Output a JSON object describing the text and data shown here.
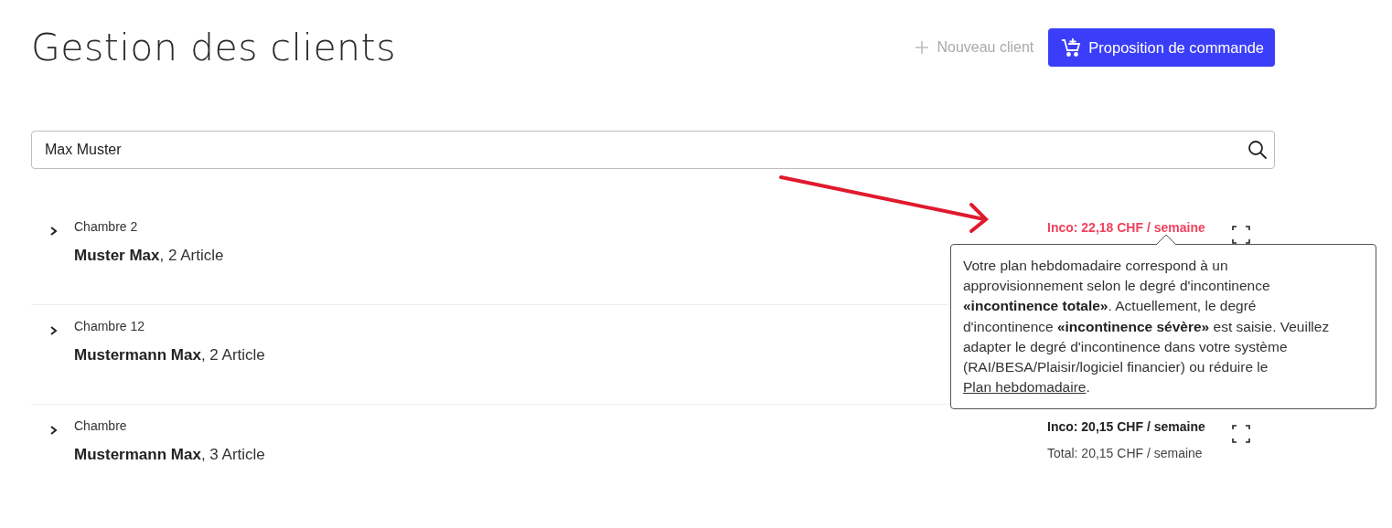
{
  "title": "Gestion des clients",
  "actions": {
    "new_client": "Nouveau client",
    "order_proposal": "Proposition de commande"
  },
  "search": {
    "value": "Max Muster"
  },
  "rows": [
    {
      "room": "Chambre 2",
      "name": "**Muster Max**, 2 Article",
      "inco": "Inco: 22,18 CHF / semaine",
      "alert": true,
      "tooltip": {
        "text": "Votre plan hebdomadaire correspond à un approvisionnement selon le degré d'incontinence **«incontinence totale»**. Actuellement, le degré d'incontinence **«incontinence sévère»** est saisie. Veuillez adapter le degré d'incontinence dans votre système (RAI/BESA/Plaisir/logiciel financier) ou réduire le ",
        "link": "Plan hebdomadaire",
        "text_end": "."
      }
    },
    {
      "room": "Chambre 12",
      "name": "**Mustermann Max**, 2 Article"
    },
    {
      "room": "Chambre",
      "name": "**Mustermann Max**, 3 Article",
      "inco": "Inco: 20,15 CHF / semaine",
      "alert": false,
      "total": "Total: 20,15 CHF / semaine"
    }
  ]
}
